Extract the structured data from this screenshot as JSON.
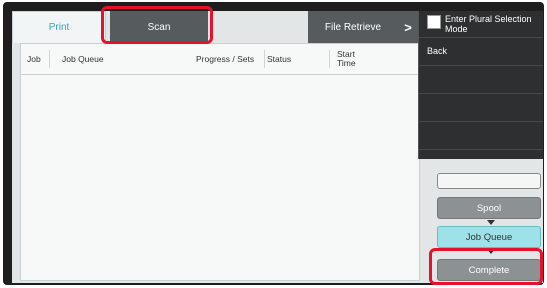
{
  "tabs": [
    {
      "label": "Print",
      "state": "active"
    },
    {
      "label": "Scan",
      "state": "inactive"
    },
    {
      "label": "File Retrieve",
      "state": "inactive"
    }
  ],
  "tab_scroll_arrow": ">",
  "job_table": {
    "columns": [
      "Job",
      "Job Queue",
      "Progress / Sets",
      "Status",
      "Start Time"
    ],
    "rows": []
  },
  "menu": {
    "plural_selection_label": "Enter Plural Selection Mode",
    "plural_selection_checked": false,
    "back_label": "Back"
  },
  "side_buttons": {
    "spool_label": "Spool",
    "job_queue_label": "Job Queue",
    "complete_label": "Complete"
  },
  "colors": {
    "highlight": "#e8102c",
    "active_tab_text": "#3aa3b7",
    "job_queue_selected": "#9fe1e8",
    "dark_button": "#565b5d"
  }
}
